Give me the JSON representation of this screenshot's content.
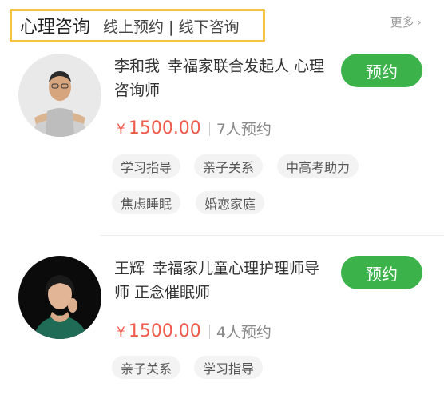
{
  "header": {
    "title": "心理咨询",
    "subtitle": "线上预约 | 线下咨询",
    "more_label": "更多",
    "more_icon": "chevron-right-icon"
  },
  "counselors": [
    {
      "name": "李和我",
      "title_line1": "幸福家联合发起人 心理",
      "title_line2": "咨询师",
      "book_label": "预约",
      "currency": "¥",
      "price": "1500.00",
      "bookings": "7人预约",
      "tags": [
        "学习指导",
        "亲子关系",
        "中高考助力",
        "焦虑睡眠",
        "婚恋家庭"
      ]
    },
    {
      "name": "王辉",
      "title_line1": "幸福家儿童心理护理师导",
      "title_line2": "师 正念催眠师",
      "book_label": "预约",
      "currency": "¥",
      "price": "1500.00",
      "bookings": "4人预约",
      "tags": [
        "亲子关系",
        "学习指导"
      ]
    }
  ],
  "colors": {
    "accent_green": "#3cb34a",
    "price_red": "#ef5a4a",
    "header_border": "#f5c542"
  }
}
